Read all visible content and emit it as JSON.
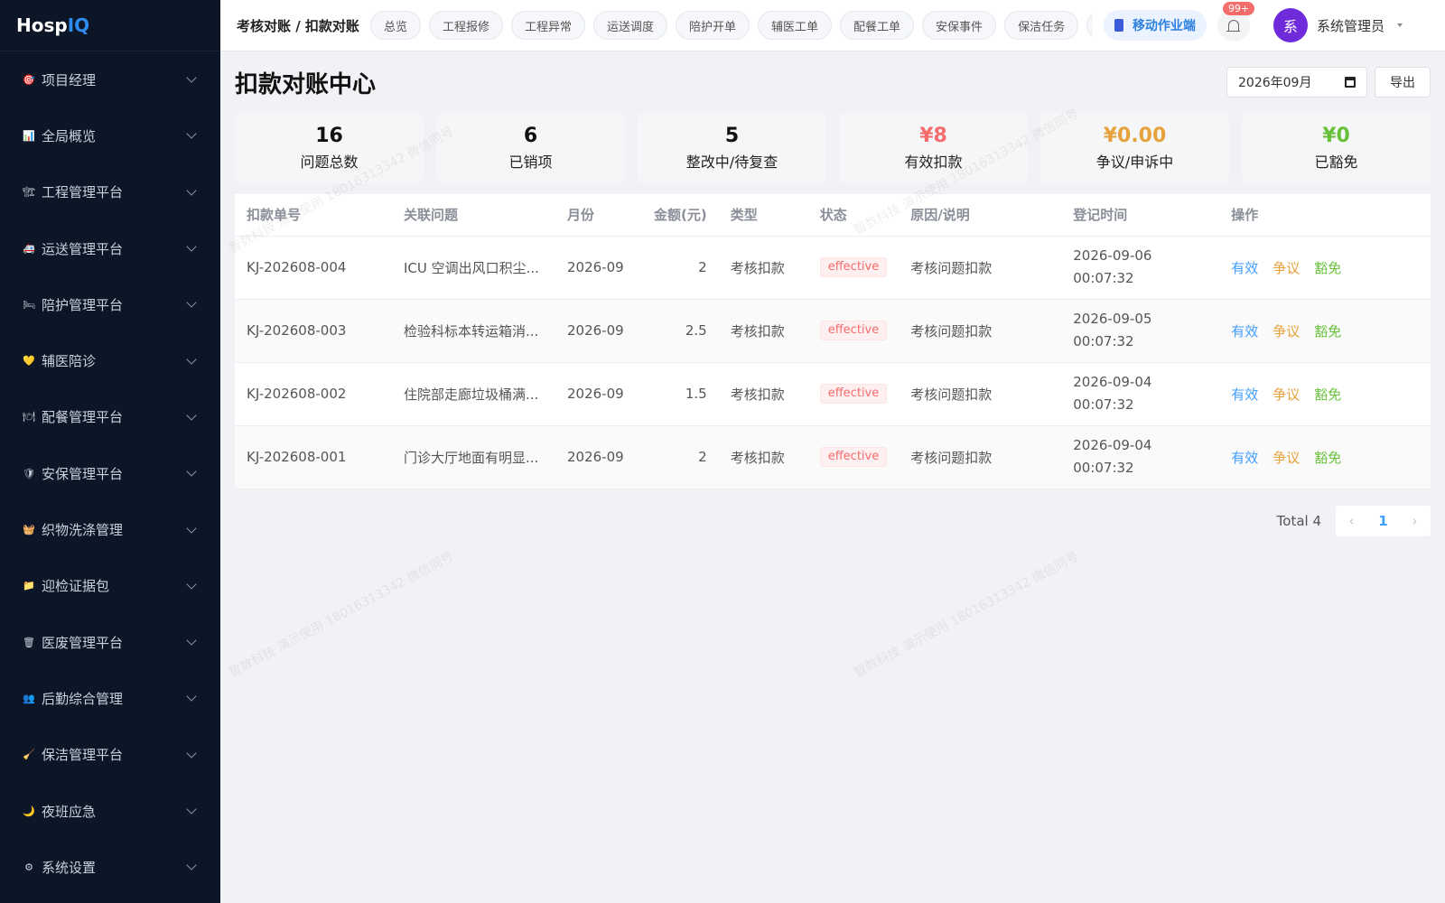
{
  "app": {
    "logo_part1": "Hosp",
    "logo_part2": "IQ"
  },
  "sidebar": {
    "items": [
      {
        "label": "项目经理",
        "icon": "🎯"
      },
      {
        "label": "全局概览",
        "icon": "📊"
      },
      {
        "label": "工程管理平台",
        "icon": "🏗"
      },
      {
        "label": "运送管理平台",
        "icon": "🚑"
      },
      {
        "label": "陪护管理平台",
        "icon": "🛏"
      },
      {
        "label": "辅医陪诊",
        "icon": "💛"
      },
      {
        "label": "配餐管理平台",
        "icon": "🍽"
      },
      {
        "label": "安保管理平台",
        "icon": "🛡"
      },
      {
        "label": "织物洗涤管理",
        "icon": "🧺"
      },
      {
        "label": "迎检证据包",
        "icon": "📁"
      },
      {
        "label": "医废管理平台",
        "icon": "🗑"
      },
      {
        "label": "后勤综合管理",
        "icon": "👥"
      },
      {
        "label": "保洁管理平台",
        "icon": "🧹"
      },
      {
        "label": "夜班应急",
        "icon": "🌙"
      },
      {
        "label": "系统设置",
        "icon": "⚙"
      }
    ]
  },
  "header": {
    "breadcrumb": "考核对账 / 扣款对账",
    "tabs": [
      "总览",
      "工程报修",
      "工程异常",
      "运送调度",
      "陪护开单",
      "辅医工单",
      "配餐工单",
      "安保事件",
      "保洁任务",
      "医"
    ],
    "mobile_label": "移动作业端",
    "notification_count": "99+",
    "avatar_text": "系",
    "username": "系统管理员"
  },
  "page": {
    "title": "扣款对账中心",
    "month_value": "2026年09月",
    "export_label": "导出"
  },
  "stats": [
    {
      "value": "16",
      "label": "问题总数",
      "tone": "default"
    },
    {
      "value": "6",
      "label": "已销项",
      "tone": "default"
    },
    {
      "value": "5",
      "label": "整改中/待复查",
      "tone": "default"
    },
    {
      "value": "¥8",
      "label": "有效扣款",
      "tone": "red"
    },
    {
      "value": "¥0.00",
      "label": "争议/申诉中",
      "tone": "orange"
    },
    {
      "value": "¥0",
      "label": "已豁免",
      "tone": "green"
    }
  ],
  "table": {
    "headers": [
      "扣款单号",
      "关联问题",
      "月份",
      "金额(元)",
      "类型",
      "状态",
      "原因/说明",
      "登记时间",
      "操作"
    ],
    "rows": [
      {
        "id": "KJ-202608-004",
        "issue": "ICU 空调出风口积尘...",
        "month": "2026-09",
        "amount": "2",
        "type": "考核扣款",
        "status": "effective",
        "reason": "考核问题扣款",
        "date": "2026-09-06",
        "time": "00:07:32"
      },
      {
        "id": "KJ-202608-003",
        "issue": "检验科标本转运箱消...",
        "month": "2026-09",
        "amount": "2.5",
        "type": "考核扣款",
        "status": "effective",
        "reason": "考核问题扣款",
        "date": "2026-09-05",
        "time": "00:07:32"
      },
      {
        "id": "KJ-202608-002",
        "issue": "住院部走廊垃圾桶满...",
        "month": "2026-09",
        "amount": "1.5",
        "type": "考核扣款",
        "status": "effective",
        "reason": "考核问题扣款",
        "date": "2026-09-04",
        "time": "00:07:32"
      },
      {
        "id": "KJ-202608-001",
        "issue": "门诊大厅地面有明显...",
        "month": "2026-09",
        "amount": "2",
        "type": "考核扣款",
        "status": "effective",
        "reason": "考核问题扣款",
        "date": "2026-09-04",
        "time": "00:07:32"
      }
    ],
    "actions": {
      "valid": "有效",
      "dispute": "争议",
      "waive": "豁免"
    }
  },
  "pagination": {
    "total_text": "Total 4",
    "current_page": "1",
    "prev_glyph": "‹",
    "next_glyph": "›"
  },
  "watermark": {
    "text": "智数科技 演示使用 18016313342 微信同号"
  },
  "colors": {
    "sidebar_bg": "#0d1627",
    "accent": "#409eff",
    "danger": "#f56c6c",
    "warning": "#e6a23c",
    "success": "#67c23a",
    "avatar": "#6f2bd9"
  }
}
